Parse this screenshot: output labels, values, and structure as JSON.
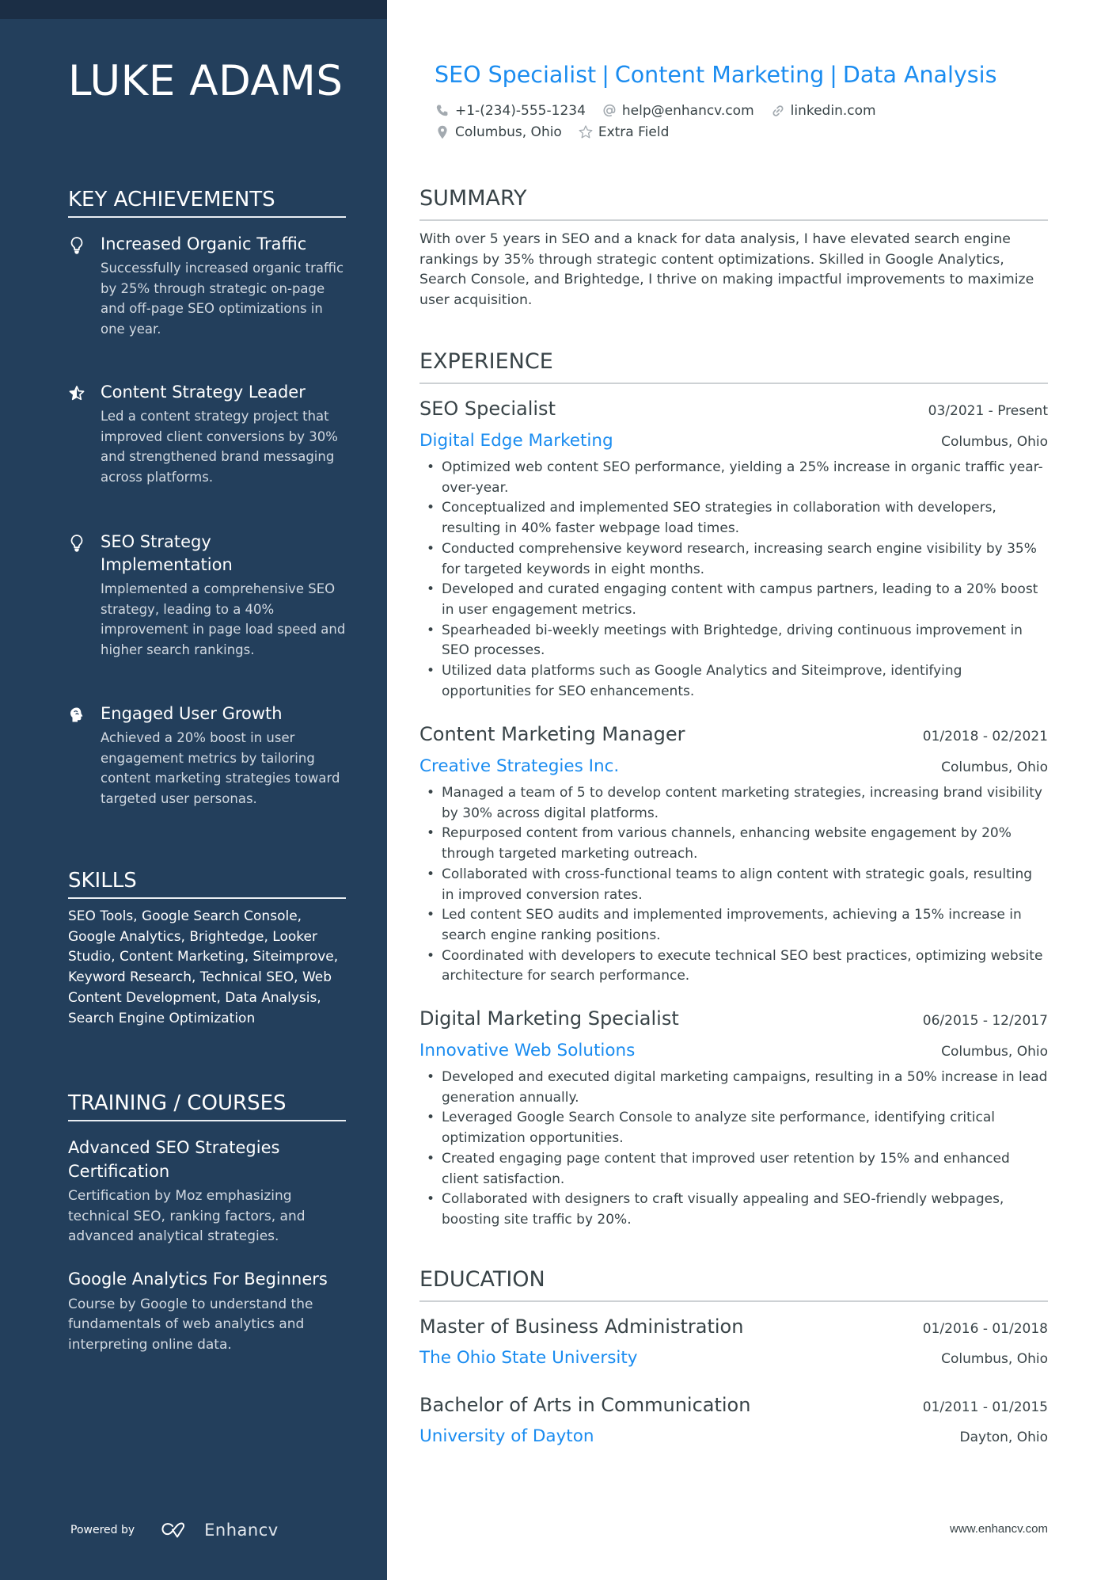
{
  "name": "LUKE ADAMS",
  "headline": [
    "SEO Specialist",
    "Content Marketing",
    "Data Analysis"
  ],
  "contact": {
    "phone": "+1-(234)-555-1234",
    "email": "help@enhancv.com",
    "website": "linkedin.com",
    "location": "Columbus, Ohio",
    "extra": "Extra Field"
  },
  "sidebar": {
    "key_achievements": {
      "heading": "KEY ACHIEVEMENTS",
      "items": [
        {
          "icon": "lightbulb-icon",
          "title": "Increased Organic Traffic",
          "description": "Successfully increased organic traffic by 25% through strategic on-page and off-page SEO optimizations in one year."
        },
        {
          "icon": "star-icon",
          "title": "Content Strategy Leader",
          "description": "Led a content strategy project that improved client conversions by 30% and strengthened brand messaging across platforms."
        },
        {
          "icon": "lightbulb-icon",
          "title": "SEO Strategy Implementation",
          "description": "Implemented a comprehensive SEO strategy, leading to a 40% improvement in page load speed and higher search rankings."
        },
        {
          "icon": "head-brain-icon",
          "title": "Engaged User Growth",
          "description": "Achieved a 20% boost in user engagement metrics by tailoring content marketing strategies toward targeted user personas."
        }
      ]
    },
    "skills": {
      "heading": "SKILLS",
      "text": "SEO Tools, Google Search Console, Google Analytics, Brightedge, Looker Studio, Content Marketing, Siteimprove, Keyword Research, Technical SEO, Web Content Development, Data Analysis, Search Engine Optimization"
    },
    "training": {
      "heading": "TRAINING / COURSES",
      "items": [
        {
          "title": "Advanced SEO Strategies Certification",
          "description": "Certification by Moz emphasizing technical SEO, ranking factors, and advanced analytical strategies."
        },
        {
          "title": "Google Analytics For Beginners",
          "description": "Course by Google to understand the fundamentals of web analytics and interpreting online data."
        }
      ]
    },
    "footer": {
      "powered_by": "Powered by",
      "brand": "Enhancv"
    }
  },
  "summary": {
    "heading": "SUMMARY",
    "text": "With over 5 years in SEO and a knack for data analysis, I have elevated search engine rankings by 35% through strategic content optimizations. Skilled in Google Analytics, Search Console, and Brightedge, I thrive on making impactful improvements to maximize user acquisition."
  },
  "experience": {
    "heading": "EXPERIENCE",
    "jobs": [
      {
        "title": "SEO Specialist",
        "dates": "03/2021 - Present",
        "company": "Digital Edge Marketing",
        "location": "Columbus, Ohio",
        "bullets": [
          "Optimized web content SEO performance, yielding a 25% increase in organic traffic year-over-year.",
          "Conceptualized and implemented SEO strategies in collaboration with developers, resulting in 40% faster webpage load times.",
          "Conducted comprehensive keyword research, increasing search engine visibility by 35% for targeted keywords in eight months.",
          "Developed and curated engaging content with campus partners, leading to a 20% boost in user engagement metrics.",
          "Spearheaded bi-weekly meetings with Brightedge, driving continuous improvement in SEO processes.",
          "Utilized data platforms such as Google Analytics and Siteimprove, identifying opportunities for SEO enhancements."
        ]
      },
      {
        "title": "Content Marketing Manager",
        "dates": "01/2018 - 02/2021",
        "company": "Creative Strategies Inc.",
        "location": "Columbus, Ohio",
        "bullets": [
          "Managed a team of 5 to develop content marketing strategies, increasing brand visibility by 30% across digital platforms.",
          "Repurposed content from various channels, enhancing website engagement by 20% through targeted marketing outreach.",
          "Collaborated with cross-functional teams to align content with strategic goals, resulting in improved conversion rates.",
          "Led content SEO audits and implemented improvements, achieving a 15% increase in search engine ranking positions.",
          "Coordinated with developers to execute technical SEO best practices, optimizing website architecture for search performance."
        ]
      },
      {
        "title": "Digital Marketing Specialist",
        "dates": "06/2015 - 12/2017",
        "company": "Innovative Web Solutions",
        "location": "Columbus, Ohio",
        "bullets": [
          "Developed and executed digital marketing campaigns, resulting in a 50% increase in lead generation annually.",
          "Leveraged Google Search Console to analyze site performance, identifying critical optimization opportunities.",
          "Created engaging page content that improved user retention by 15% and enhanced client satisfaction.",
          "Collaborated with designers to craft visually appealing and SEO-friendly webpages, boosting site traffic by 20%."
        ]
      }
    ]
  },
  "education": {
    "heading": "EDUCATION",
    "items": [
      {
        "degree": "Master of Business Administration",
        "dates": "01/2016 - 01/2018",
        "school": "The Ohio State University",
        "location": "Columbus, Ohio"
      },
      {
        "degree": "Bachelor of Arts in Communication",
        "dates": "01/2011 - 01/2015",
        "school": "University of Dayton",
        "location": "Dayton, Ohio"
      }
    ]
  },
  "footer_url": "www.enhancv.com",
  "colors": {
    "sidebar_bg": "#233f5c",
    "sidebar_topband": "#1b2e45",
    "accent": "#1a8cf0",
    "text": "#384347"
  }
}
